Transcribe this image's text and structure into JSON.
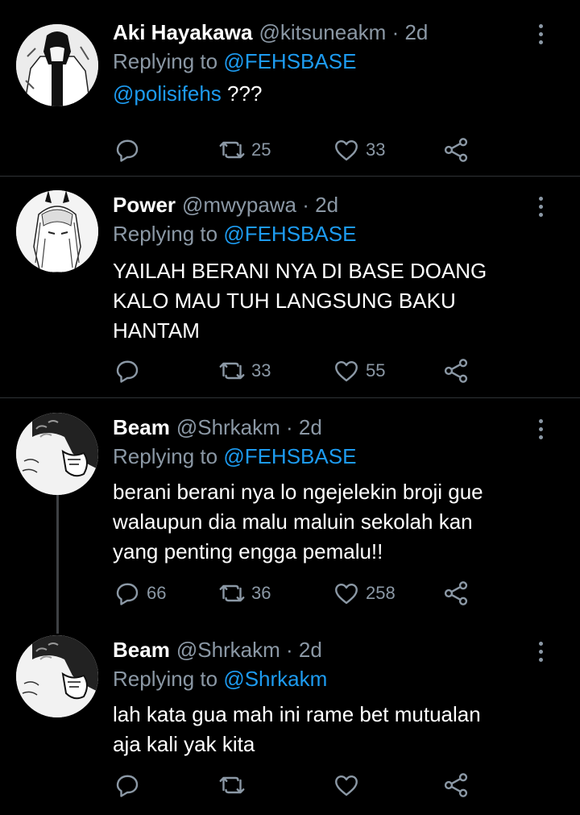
{
  "tweets": [
    {
      "name": "Aki Hayakawa",
      "handle": "@kitsuneakm",
      "time": "2d",
      "replying_prefix": "Replying to ",
      "replying_to": "@FEHSBASE",
      "body_mention": "@polisifehs",
      "body": " ???",
      "replies": "",
      "retweets": "25",
      "likes": "33"
    },
    {
      "name": "Power",
      "handle": "@mwypawa",
      "time": "2d",
      "replying_prefix": "Replying to ",
      "replying_to": "@FEHSBASE",
      "body": "YAILAH BERANI NYA DI BASE DOANG\nKALO MAU TUH LANGSUNG BAKU\nHANTAM",
      "replies": "",
      "retweets": "33",
      "likes": "55"
    },
    {
      "name": "Beam",
      "handle": "@Shrkakm",
      "time": "2d",
      "replying_prefix": "Replying to ",
      "replying_to": "@FEHSBASE",
      "body": "berani berani nya lo ngejelekin broji gue\nwalaupun dia malu maluin sekolah kan\nyang penting engga pemalu!!",
      "replies": "66",
      "retweets": "36",
      "likes": "258"
    },
    {
      "name": "Beam",
      "handle": "@Shrkakm",
      "time": "2d",
      "replying_prefix": "Replying to ",
      "replying_to": "@Shrkakm",
      "body": "lah kata gua mah ini rame bet mutualan\naja kali yak kita",
      "replies": "",
      "retweets": "",
      "likes": ""
    }
  ],
  "separator": " · ",
  "colors": {
    "background": "#000000",
    "muted": "#8b98a5",
    "mention": "#1d9bf0",
    "divider": "#2f3336"
  },
  "icons": [
    "reply-icon",
    "retweet-icon",
    "like-icon",
    "share-icon",
    "more-icon"
  ]
}
